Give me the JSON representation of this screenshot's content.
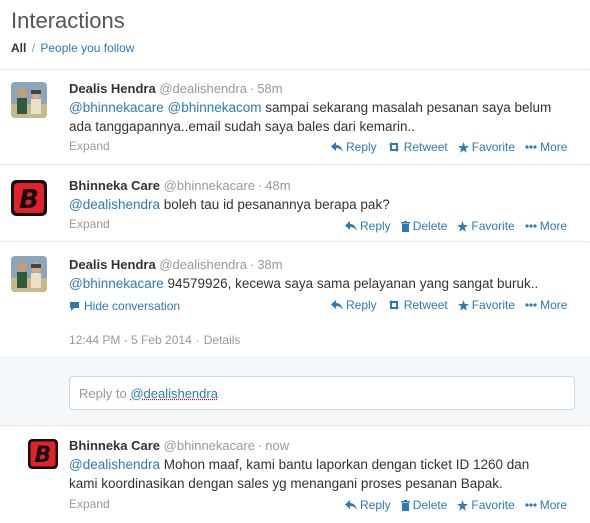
{
  "header": {
    "title": "Interactions",
    "filter_all": "All",
    "filter_sep": "/",
    "filter_people": "People you follow"
  },
  "tweets": [
    {
      "name": "Dealis Hendra",
      "handle": "@dealishendra",
      "time": "58m",
      "line1_mentions": [
        "@bhinnekacare",
        "@bhinnekacom"
      ],
      "line1_text": " sampai sekarang masalah pesanan saya belum",
      "line2_text": "ada tanggapannya..email sudah saya bales dari kemarin..",
      "expand": "Expand",
      "actions": [
        "Reply",
        "Retweet",
        "Favorite",
        "More"
      ]
    },
    {
      "name": "Bhinneka Care",
      "handle": "@bhinnekacare",
      "time": "48m",
      "mention": "@dealishendra",
      "text": " boleh tau id pesanannya berapa pak?",
      "expand": "Expand",
      "actions": [
        "Reply",
        "Delete",
        "Favorite",
        "More"
      ]
    },
    {
      "name": "Dealis Hendra",
      "handle": "@dealishendra",
      "time": "38m",
      "mention": "@bhinnekacare",
      "text": " 94579926, kecewa saya sama pelayanan yang sangat buruk..",
      "hide": "Hide conversation",
      "actions": [
        "Reply",
        "Retweet",
        "Favorite",
        "More"
      ],
      "timestamp": "12:44 PM - 5 Feb 2014",
      "details": "Details"
    },
    {
      "name": "Bhinneka Care",
      "handle": "@bhinnekacare",
      "time": "now",
      "mention": "@dealishendra",
      "line1_text": " Mohon maaf, kami bantu laporkan dengan ticket ID 1260 dan",
      "line2_text": "kami koordinasikan dengan sales yg menangani proses pesanan Bapak.",
      "expand": "Expand",
      "actions": [
        "Reply",
        "Delete",
        "Favorite",
        "More"
      ]
    }
  ],
  "reply_box": {
    "prefix": "Reply to ",
    "mention": "@dealishendra"
  },
  "colors": {
    "link": "#2b7bb9",
    "muted": "#999999",
    "brand_red": "#e4202b"
  }
}
